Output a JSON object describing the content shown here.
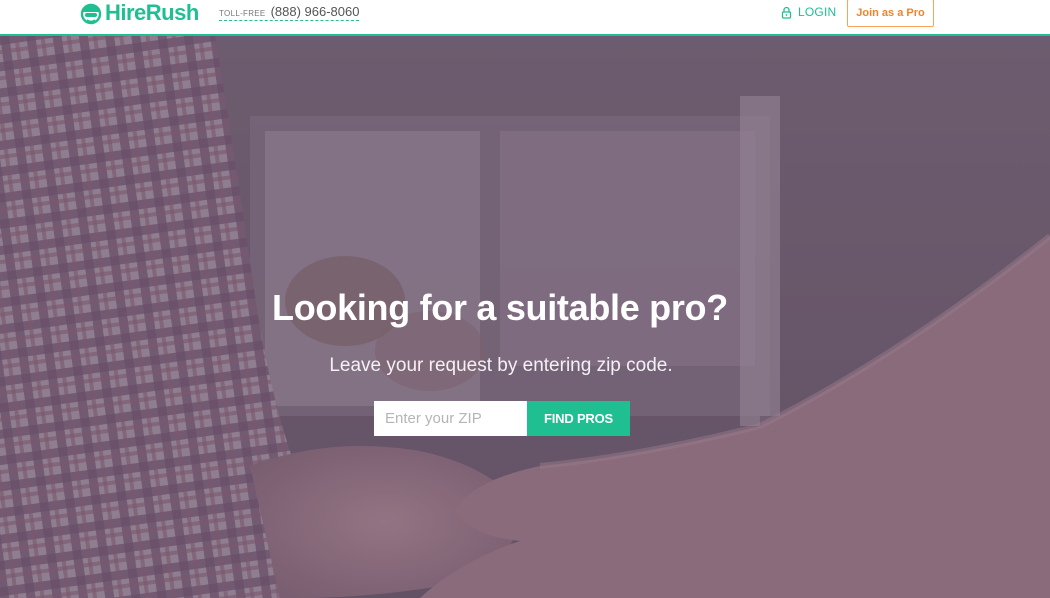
{
  "header": {
    "logo_text": "HireRush",
    "phone_label": "TOLL-FREE",
    "phone_number": "(888) 966-8060",
    "login_label": "LOGIN",
    "join_label": "Join as a Pro"
  },
  "hero": {
    "headline": "Looking for a suitable pro?",
    "subline": "Leave your request by entering zip code.",
    "zip_placeholder": "Enter your ZIP",
    "zip_value": "",
    "find_button_label": "FIND PROS"
  },
  "colors": {
    "brand_green": "#1fbf92",
    "accent_orange": "#f0842e",
    "overlay_purple": "#6e5c6d"
  },
  "icons": {
    "logo_mark": "hirerush-mascot-icon",
    "login": "lock-icon"
  }
}
